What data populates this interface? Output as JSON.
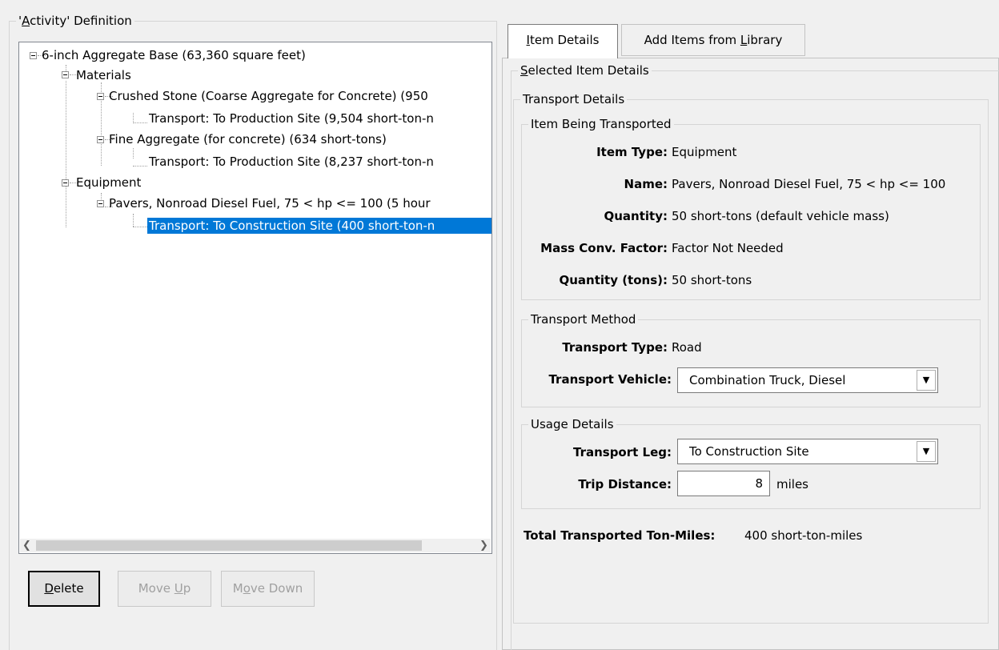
{
  "left_group": {
    "title_prefix": "'",
    "title_mnemonic": "A",
    "title_rest": "ctivity' Definition"
  },
  "tree": {
    "nodes": [
      {
        "label": "6-inch Aggregate Base (63,360 square feet)"
      },
      {
        "label": "Materials"
      },
      {
        "label": "Crushed Stone (Coarse Aggregate for Concrete) (950"
      },
      {
        "label": "Transport: To Production Site (9,504 short-ton-n"
      },
      {
        "label": "Fine Aggregate (for concrete) (634 short-tons)"
      },
      {
        "label": "Transport: To Production Site (8,237 short-ton-n"
      },
      {
        "label": "Equipment"
      },
      {
        "label": "Pavers, Nonroad Diesel Fuel, 75 < hp <= 100 (5 hour"
      },
      {
        "label": "Transport: To Construction Site (400 short-ton-n",
        "selected": true
      }
    ]
  },
  "buttons": {
    "delete_mn": "D",
    "delete_rest": "elete",
    "moveup_pre": "Move ",
    "moveup_mn": "U",
    "moveup_rest": "p",
    "movedown_pre": "M",
    "movedown_mn": "o",
    "movedown_rest": "ve Down"
  },
  "tabs": {
    "item_details_mn": "I",
    "item_details_rest": "tem Details",
    "add_items_pre": "Add Items from ",
    "add_items_mn": "L",
    "add_items_rest": "ibrary"
  },
  "selected_item": {
    "title_mn": "S",
    "title_rest": "elected Item Details",
    "transport_details": "Transport Details",
    "item_being_transported": {
      "title": "Item Being Transported",
      "item_type_label": "Item Type:",
      "item_type": "Equipment",
      "name_label": "Name:",
      "name": "Pavers, Nonroad Diesel Fuel, 75 < hp <= 100",
      "quantity_label": "Quantity:",
      "quantity": "50 short-tons (default vehicle mass)",
      "mass_conv_label": "Mass Conv. Factor:",
      "mass_conv": "Factor Not Needed",
      "quantity_tons_label": "Quantity (tons):",
      "quantity_tons": "50 short-tons"
    },
    "transport_method": {
      "title": "Transport Method",
      "transport_type_label": "Transport Type:",
      "transport_type": "Road",
      "vehicle_label": "Transport Vehicle:",
      "vehicle": "Combination Truck, Diesel"
    },
    "usage_details": {
      "title": "Usage Details",
      "leg_label": "Transport Leg:",
      "leg": "To Construction Site",
      "distance_label": "Trip Distance:",
      "distance": "8",
      "distance_unit": "miles"
    },
    "total_label": "Total Transported Ton-Miles:",
    "total": "400 short-ton-miles"
  },
  "colors": {
    "selection": "#0078d7",
    "window": "#f0f0f0"
  },
  "icons": [
    "collapse-icon",
    "scroll-left-icon",
    "scroll-right-icon",
    "dropdown-arrow-icon"
  ]
}
